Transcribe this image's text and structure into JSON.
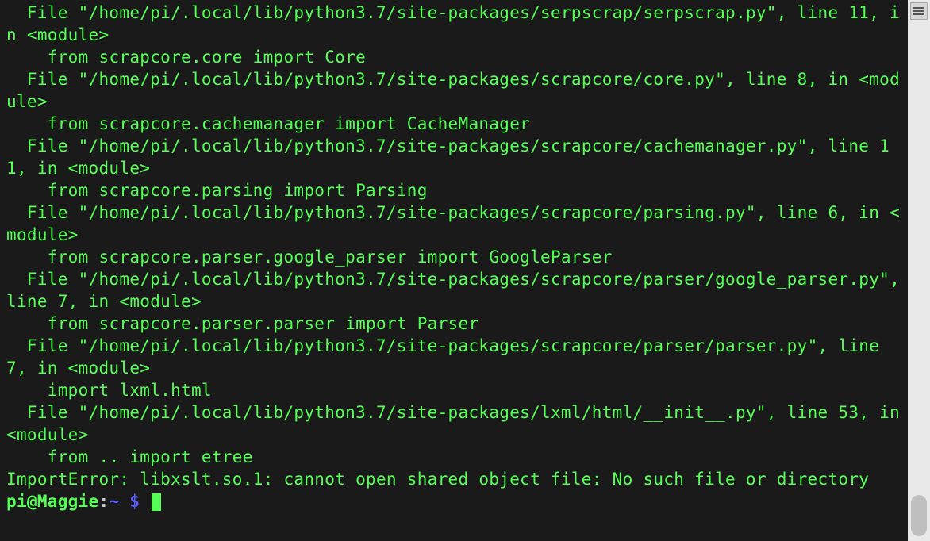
{
  "terminal": {
    "lines": [
      "  File \"/home/pi/.local/lib/python3.7/site-packages/serpscrap/serpscrap.py\", line 11, in <module>",
      "    from scrapcore.core import Core",
      "  File \"/home/pi/.local/lib/python3.7/site-packages/scrapcore/core.py\", line 8, in <module>",
      "    from scrapcore.cachemanager import CacheManager",
      "  File \"/home/pi/.local/lib/python3.7/site-packages/scrapcore/cachemanager.py\", line 11, in <module>",
      "    from scrapcore.parsing import Parsing",
      "  File \"/home/pi/.local/lib/python3.7/site-packages/scrapcore/parsing.py\", line 6, in <module>",
      "    from scrapcore.parser.google_parser import GoogleParser",
      "  File \"/home/pi/.local/lib/python3.7/site-packages/scrapcore/parser/google_parser.py\", line 7, in <module>",
      "    from scrapcore.parser.parser import Parser",
      "  File \"/home/pi/.local/lib/python3.7/site-packages/scrapcore/parser/parser.py\", line 7, in <module>",
      "    import lxml.html",
      "  File \"/home/pi/.local/lib/python3.7/site-packages/lxml/html/__init__.py\", line 53, in <module>",
      "    from .. import etree",
      "ImportError: libxslt.so.1: cannot open shared object file: No such file or directory"
    ],
    "prompt": {
      "userhost": "pi@Maggie",
      "sep": ":",
      "path": "~",
      "dollar": " $ "
    }
  }
}
